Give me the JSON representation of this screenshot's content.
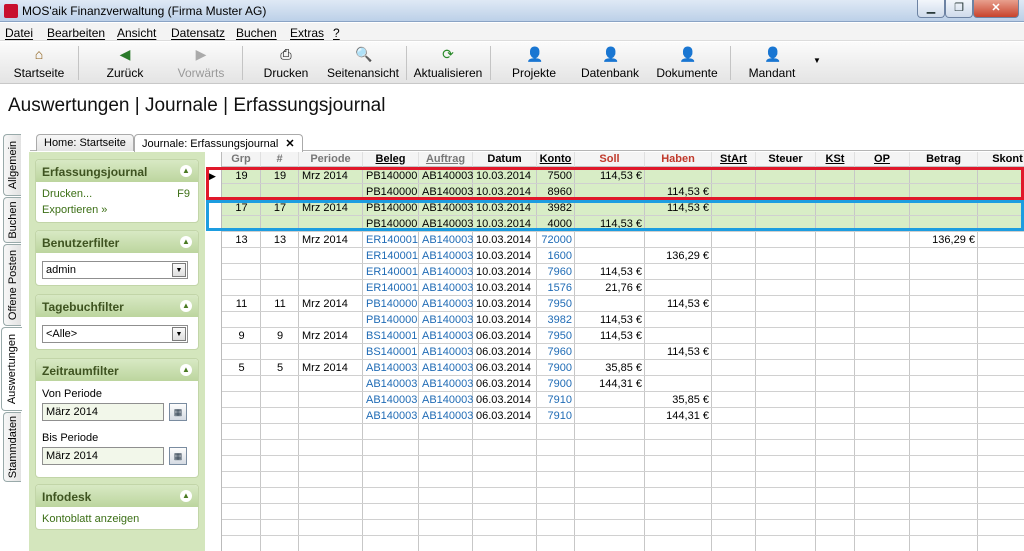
{
  "window": {
    "title": "MOS'aik Finanzverwaltung (Firma Muster AG)",
    "min": "▁",
    "max": "❐",
    "close": "✕"
  },
  "menu": [
    "Datei",
    "Bearbeiten",
    "Ansicht",
    "Datensatz",
    "Buchen",
    "Extras",
    "?"
  ],
  "toolbar": {
    "startseite": "Startseite",
    "zurueck": "Zurück",
    "vorwaerts": "Vorwärts",
    "drucken": "Drucken",
    "seitenansicht": "Seitenansicht",
    "aktualisieren": "Aktualisieren",
    "projekte": "Projekte",
    "datenbank": "Datenbank",
    "dokumente": "Dokumente",
    "mandant": "Mandant"
  },
  "icons": {
    "home": "⌂",
    "back": "◀",
    "forward": "▶",
    "print": "⎙",
    "preview": "🔍",
    "refresh": "⟳",
    "people": "👤",
    "dropdown": "▼",
    "collapse": "▲",
    "calendar": "▦",
    "rowpointer": "▶"
  },
  "page_title": "Auswertungen | Journale | Erfassungsjournal",
  "vertical_tabs": [
    "Allgemein",
    "Buchen",
    "Offene Posten",
    "Auswertungen",
    "Stammdaten"
  ],
  "doc_tabs": [
    "Home: Startseite",
    "Journale: Erfassungsjournal"
  ],
  "doc_tab_close": "✕",
  "side": {
    "erfassungsjournal": {
      "title": "Erfassungsjournal",
      "drucken": "Drucken...",
      "drucken_key": "F9",
      "exportieren": "Exportieren »"
    },
    "benutzerfilter": {
      "title": "Benutzerfilter",
      "value": "admin"
    },
    "tagebuchfilter": {
      "title": "Tagebuchfilter",
      "value": "<Alle>"
    },
    "zeitraumfilter": {
      "title": "Zeitraumfilter",
      "von_label": "Von Periode",
      "von": "März 2014",
      "bis_label": "Bis Periode",
      "bis": "März 2014"
    },
    "infodesk": {
      "title": "Infodesk",
      "link": "Kontoblatt anzeigen"
    }
  },
  "columns": [
    "Grp",
    "#",
    "Periode",
    "Beleg",
    "Auftrag",
    "Datum",
    "Konto",
    "Soll",
    "Haben",
    "StArt",
    "Steuer",
    "KSt",
    "OP",
    "Betrag",
    "Skont"
  ],
  "rows": [
    {
      "grp": "19",
      "nr": "19",
      "periode": "Mrz 2014",
      "beleg": "PB140000",
      "auftrag": "AB140003",
      "datum": "10.03.2014",
      "konto": "7500",
      "soll": "114,53 €",
      "haben": "",
      "betrag": "",
      "blue": false
    },
    {
      "grp": "",
      "nr": "",
      "periode": "",
      "beleg": "PB140000",
      "auftrag": "AB140003",
      "datum": "10.03.2014",
      "konto": "8960",
      "soll": "",
      "haben": "114,53 €",
      "betrag": "",
      "blue": false
    },
    {
      "grp": "17",
      "nr": "17",
      "periode": "Mrz 2014",
      "beleg": "PB140000",
      "auftrag": "AB140003",
      "datum": "10.03.2014",
      "konto": "3982",
      "soll": "",
      "haben": "114,53 €",
      "betrag": "",
      "blue": false
    },
    {
      "grp": "",
      "nr": "",
      "periode": "",
      "beleg": "PB140000",
      "auftrag": "AB140003",
      "datum": "10.03.2014",
      "konto": "4000",
      "soll": "114,53 €",
      "haben": "",
      "betrag": "",
      "blue": false
    },
    {
      "grp": "13",
      "nr": "13",
      "periode": "Mrz 2014",
      "beleg": "ER140001",
      "auftrag": "AB140003",
      "datum": "10.03.2014",
      "konto": "72000",
      "soll": "",
      "haben": "",
      "betrag": "136,29 €",
      "blue": true
    },
    {
      "grp": "",
      "nr": "",
      "periode": "",
      "beleg": "ER140001",
      "auftrag": "AB140003",
      "datum": "10.03.2014",
      "konto": "1600",
      "soll": "",
      "haben": "136,29 €",
      "betrag": "",
      "blue": true
    },
    {
      "grp": "",
      "nr": "",
      "periode": "",
      "beleg": "ER140001",
      "auftrag": "AB140003",
      "datum": "10.03.2014",
      "konto": "7960",
      "soll": "114,53 €",
      "haben": "",
      "betrag": "",
      "blue": true
    },
    {
      "grp": "",
      "nr": "",
      "periode": "",
      "beleg": "ER140001",
      "auftrag": "AB140003",
      "datum": "10.03.2014",
      "konto": "1576",
      "soll": "21,76 €",
      "haben": "",
      "betrag": "",
      "blue": true
    },
    {
      "grp": "11",
      "nr": "11",
      "periode": "Mrz 2014",
      "beleg": "PB140000",
      "auftrag": "AB140003",
      "datum": "10.03.2014",
      "konto": "7950",
      "soll": "",
      "haben": "114,53 €",
      "betrag": "",
      "blue": true
    },
    {
      "grp": "",
      "nr": "",
      "periode": "",
      "beleg": "PB140000",
      "auftrag": "AB140003",
      "datum": "10.03.2014",
      "konto": "3982",
      "soll": "114,53 €",
      "haben": "",
      "betrag": "",
      "blue": true
    },
    {
      "grp": "9",
      "nr": "9",
      "periode": "Mrz 2014",
      "beleg": "BS140001",
      "auftrag": "AB140003",
      "datum": "06.03.2014",
      "konto": "7950",
      "soll": "114,53 €",
      "haben": "",
      "betrag": "",
      "blue": true
    },
    {
      "grp": "",
      "nr": "",
      "periode": "",
      "beleg": "BS140001",
      "auftrag": "AB140003",
      "datum": "06.03.2014",
      "konto": "7960",
      "soll": "",
      "haben": "114,53 €",
      "betrag": "",
      "blue": true
    },
    {
      "grp": "5",
      "nr": "5",
      "periode": "Mrz 2014",
      "beleg": "AB140003",
      "auftrag": "AB140003",
      "datum": "06.03.2014",
      "konto": "7900",
      "soll": "35,85 €",
      "haben": "",
      "betrag": "",
      "blue": true
    },
    {
      "grp": "",
      "nr": "",
      "periode": "",
      "beleg": "AB140003",
      "auftrag": "AB140003",
      "datum": "06.03.2014",
      "konto": "7900",
      "soll": "144,31 €",
      "haben": "",
      "betrag": "",
      "blue": true
    },
    {
      "grp": "",
      "nr": "",
      "periode": "",
      "beleg": "AB140003",
      "auftrag": "AB140003",
      "datum": "06.03.2014",
      "konto": "7910",
      "soll": "",
      "haben": "35,85 €",
      "betrag": "",
      "blue": true
    },
    {
      "grp": "",
      "nr": "",
      "periode": "",
      "beleg": "AB140003",
      "auftrag": "AB140003",
      "datum": "06.03.2014",
      "konto": "7910",
      "soll": "",
      "haben": "144,31 €",
      "betrag": "",
      "blue": true
    }
  ]
}
